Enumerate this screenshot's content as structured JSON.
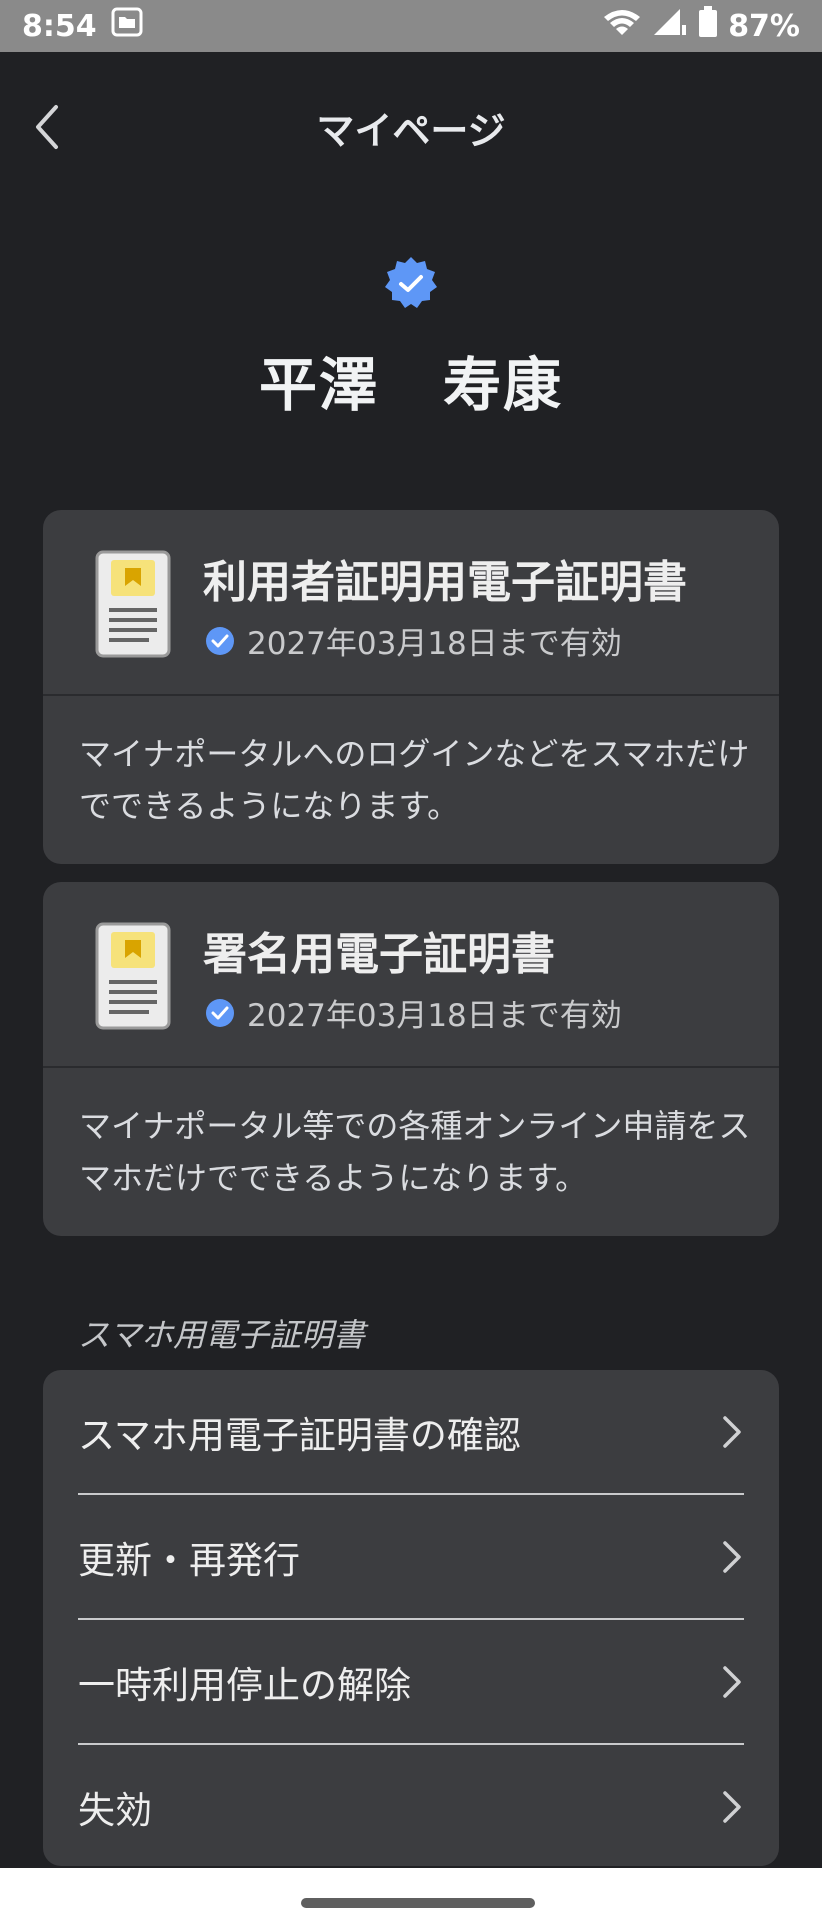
{
  "status_bar": {
    "time": "8:54",
    "battery": "87%",
    "icons": [
      "folder-notification-icon",
      "wifi-icon",
      "signal-icon",
      "battery-icon"
    ]
  },
  "app_bar": {
    "title": "マイページ",
    "back_icon": "chevron-left-icon"
  },
  "user": {
    "badge_icon": "verified-badge-icon",
    "family_name": "平澤",
    "given_name": "寿康"
  },
  "certificates": [
    {
      "title": "利用者証明用電子証明書",
      "validity": "2027年03月18日まで有効",
      "description": "マイナポータルへのログインなどをスマホだけでできるようになります。"
    },
    {
      "title": "署名用電子証明書",
      "validity": "2027年03月18日まで有効",
      "description": "マイナポータル等での各種オンライン申請をスマホだけでできるようになります。"
    }
  ],
  "section": {
    "label": "スマホ用電子証明書"
  },
  "menu": [
    {
      "label": "スマホ用電子証明書の確認"
    },
    {
      "label": "更新・再発行"
    },
    {
      "label": "一時利用停止の解除"
    },
    {
      "label": "失効"
    }
  ],
  "colors": {
    "background": "#202124",
    "card": "#3c3d40",
    "status_bar": "#8a8a8a",
    "accent_blue": "#5e97f6",
    "bookmark_yellow": "#f2c230"
  }
}
